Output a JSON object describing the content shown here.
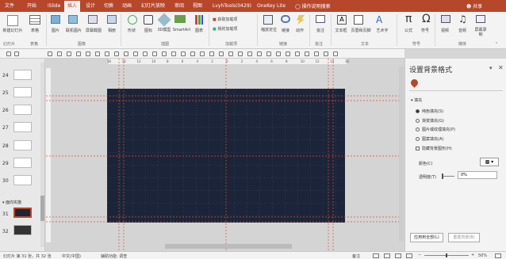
{
  "tabs": [
    "文件",
    "开始",
    "iSlide",
    "插入",
    "设计",
    "切换",
    "动画",
    "幻灯片放映",
    "审阅",
    "视图",
    "LvyhTools(0429)",
    "OneKey Lite"
  ],
  "active_tab": "插入",
  "tell_me": "操作说明搜索",
  "share": "共享",
  "ribbon": {
    "buttons": [
      "新建幻灯片",
      "表格",
      "图片",
      "联机图片",
      "屏幕截图",
      "相册",
      "形状",
      "图标",
      "3D模型",
      "SmartArt",
      "图表",
      "获取加载项",
      "我的加载项",
      "缩放定位",
      "链接",
      "动作",
      "批注",
      "文本框",
      "页眉和页脚",
      "艺术字",
      "公式",
      "符号",
      "视频",
      "音频",
      "屏幕录制"
    ],
    "groups": [
      "幻灯片",
      "表格",
      "图像",
      "插图",
      "加载项",
      "链接",
      "批注",
      "文本",
      "符号",
      "媒体"
    ]
  },
  "ruler_h": [
    "16",
    "14",
    "12",
    "10",
    "8",
    "6",
    "4",
    "2",
    "0",
    "2",
    "4",
    "6",
    "8",
    "10",
    "12",
    "14",
    "16"
  ],
  "thumbs": [
    {
      "num": "24"
    },
    {
      "num": "25"
    },
    {
      "num": "26"
    },
    {
      "num": "27"
    },
    {
      "num": "28"
    },
    {
      "num": "29"
    },
    {
      "num": "30"
    },
    {
      "num": "31"
    },
    {
      "num": "32"
    }
  ],
  "section_label": "面向实施",
  "panel": {
    "title": "设置背景格式",
    "section": "填充",
    "options": [
      "纯色填充(S)",
      "渐变填充(G)",
      "图片或纹理填充(P)",
      "图案填充(A)"
    ],
    "checkbox": "隐藏背景图形(H)",
    "color_label": "颜色(C)",
    "transparency_label": "透明度(T)",
    "transparency_value": "0%",
    "apply_all": "应用到全部(L)",
    "reset": "重置背景(B)"
  },
  "status": {
    "slide_info": "幻灯片 第 31 张，共 32 张",
    "language": "中文(中国)",
    "accessibility": "辅助功能: 调查",
    "notes": "备注",
    "zoom": "50%"
  },
  "colors": {
    "accent": "#b7472a",
    "slide_bg": "#1b2438",
    "guide": "#e0503a"
  }
}
